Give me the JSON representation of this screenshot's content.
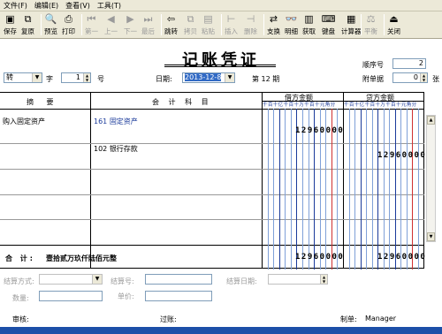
{
  "menu": [
    "文件(F)",
    "编辑(E)",
    "查看(V)",
    "工具(T)"
  ],
  "toolbar": [
    {
      "label": "保存",
      "icon": "save-icon",
      "glyph": "▣",
      "enabled": true
    },
    {
      "label": "复原",
      "icon": "restore-icon",
      "glyph": "⧉",
      "enabled": true
    },
    {
      "label": "预览",
      "icon": "preview-icon",
      "glyph": "🔍",
      "enabled": true
    },
    {
      "label": "打印",
      "icon": "print-icon",
      "glyph": "⎙",
      "enabled": true
    },
    {
      "label": "第一",
      "icon": "first-icon",
      "glyph": "⏮",
      "enabled": false
    },
    {
      "label": "上一",
      "icon": "prev-icon",
      "glyph": "◀",
      "enabled": false
    },
    {
      "label": "下一",
      "icon": "next-icon",
      "glyph": "▶",
      "enabled": false
    },
    {
      "label": "最后",
      "icon": "last-icon",
      "glyph": "⏭",
      "enabled": false
    },
    {
      "label": "跳转",
      "icon": "jump-icon",
      "glyph": "⇦",
      "enabled": true
    },
    {
      "label": "拷贝",
      "icon": "copy-icon",
      "glyph": "⧉",
      "enabled": false
    },
    {
      "label": "粘贴",
      "icon": "paste-icon",
      "glyph": "▤",
      "enabled": false
    },
    {
      "label": "插入",
      "icon": "insert-icon",
      "glyph": "⊢",
      "enabled": false
    },
    {
      "label": "删除",
      "icon": "delete-icon",
      "glyph": "⊣",
      "enabled": false
    },
    {
      "label": "支换",
      "icon": "swap-icon",
      "glyph": "⇄",
      "enabled": true
    },
    {
      "label": "明细",
      "icon": "detail-icon",
      "glyph": "👓",
      "enabled": true
    },
    {
      "label": "获取",
      "icon": "fetch-icon",
      "glyph": "▥",
      "enabled": true
    },
    {
      "label": "键盘",
      "icon": "keyboard-icon",
      "glyph": "⌨",
      "enabled": true
    },
    {
      "label": "计算器",
      "icon": "calculator-icon",
      "glyph": "▦",
      "enabled": true
    },
    {
      "label": "平衡",
      "icon": "balance-icon",
      "glyph": "⚖",
      "enabled": false
    },
    {
      "label": "关闭",
      "icon": "close-icon",
      "glyph": "⏏",
      "enabled": true
    }
  ],
  "voucher": {
    "title": "记账凭证",
    "type": "转",
    "zi": "字",
    "number": "1",
    "hao": "号",
    "date_label": "日期:",
    "date": "2013-12-8",
    "period": "第 12 期",
    "seq_label": "顺序号",
    "seq": "2",
    "attach_label": "附单据",
    "attach": "0",
    "attach_unit": "张"
  },
  "table": {
    "col_summary": "摘 要",
    "col_account": "会 计 科 目",
    "col_debit": "借方金额",
    "col_credit": "贷方金额",
    "digit_header": "千百十亿千百十万千百十元角分",
    "rows": [
      {
        "summary": "购入固定资产",
        "account": "161 固定资产",
        "debit": "12960000",
        "credit": ""
      },
      {
        "summary": "",
        "account": "102 银行存款",
        "debit": "",
        "credit": "12960000"
      },
      {
        "summary": "",
        "account": "",
        "debit": "",
        "credit": ""
      },
      {
        "summary": "",
        "account": "",
        "debit": "",
        "credit": ""
      },
      {
        "summary": "",
        "account": "",
        "debit": "",
        "credit": ""
      }
    ],
    "total_label": "合 计:",
    "total_words": "壹拾贰万玖仟陆佰元整",
    "total_debit": "12960000",
    "total_credit": "12960000"
  },
  "settlement": {
    "method_label": "结算方式:",
    "number_label": "结算号:",
    "date_label": "结算日期:",
    "qty_label": "数量:",
    "price_label": "单价:"
  },
  "footer": {
    "review": "审核:",
    "posting": "过账:",
    "maker_label": "制单:",
    "maker": "Manager"
  }
}
